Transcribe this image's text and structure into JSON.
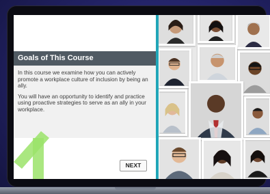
{
  "course_panel": {
    "title": "Goals of This Course",
    "paragraph_1": "In this course we examine how you can actively promote a workplace culture of inclusion by being an ally.",
    "paragraph_2": "You will have an opportunity to identify and practice using proactive strategies to serve as an ally in your workplace."
  },
  "navigation": {
    "next_label": "NEXT"
  },
  "colors": {
    "accent_teal": "#21a6b8",
    "header_gray": "#505a63",
    "body_gray": "#f1f1f1",
    "arrow_green": "#9be36a",
    "background_navy": "#24246a"
  },
  "photo_grid": {
    "tiles": [
      {
        "name": "portrait-woman-1"
      },
      {
        "name": "portrait-woman-2"
      },
      {
        "name": "portrait-woman-3"
      },
      {
        "name": "portrait-man-1"
      },
      {
        "name": "portrait-man-2"
      },
      {
        "name": "portrait-man-3"
      },
      {
        "name": "portrait-woman-4"
      },
      {
        "name": "portrait-man-4"
      },
      {
        "name": "portrait-man-5"
      },
      {
        "name": "portrait-man-6"
      },
      {
        "name": "portrait-woman-5"
      },
      {
        "name": "portrait-woman-6"
      }
    ]
  }
}
